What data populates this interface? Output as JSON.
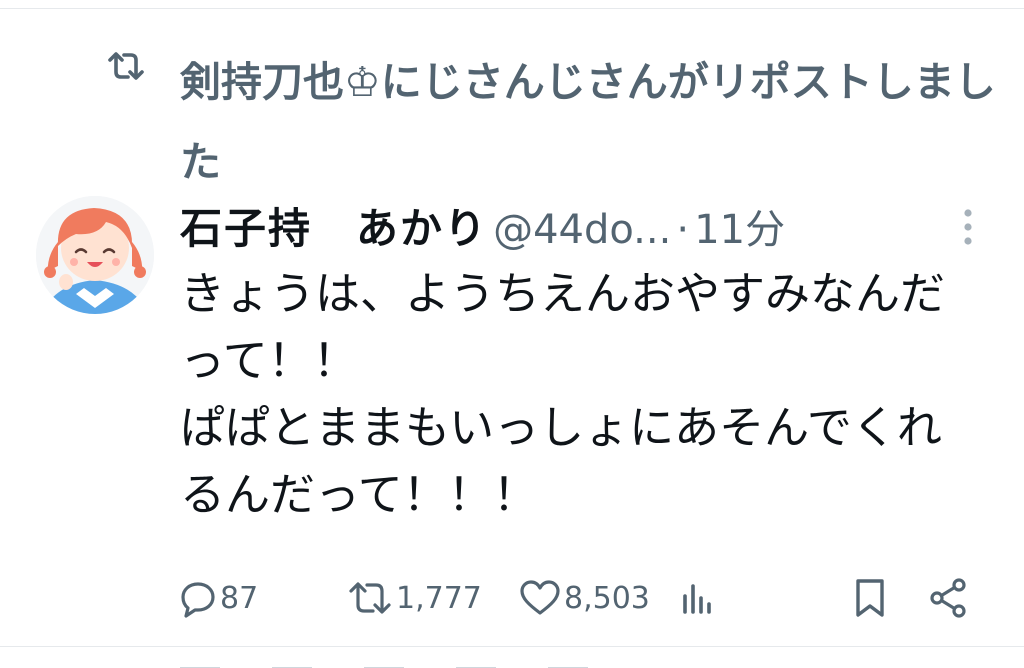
{
  "repost": {
    "text": "剣持刀也♔にじさんじさんがリポストしました",
    "icon": "repost-icon"
  },
  "tweet": {
    "display_name": "石子持　あかり",
    "handle": "@44do...",
    "separator": "·",
    "time": "11分",
    "text": "きょうは、ようちえんおやすみなんだって！！\nぱぱとままもいっしょにあそんでくれるんだって！！！"
  },
  "actions": {
    "reply": {
      "count": "87",
      "icon": "reply-icon"
    },
    "repost": {
      "count": "1,777",
      "icon": "repost-icon"
    },
    "like": {
      "count": "8,503",
      "icon": "heart-icon"
    },
    "views": {
      "icon": "analytics-icon"
    },
    "bookmark": {
      "icon": "bookmark-icon"
    },
    "share": {
      "icon": "share-icon"
    }
  },
  "colors": {
    "text_primary": "#0f1419",
    "text_secondary": "#536471",
    "avatar_hair": "#f07b5e"
  }
}
